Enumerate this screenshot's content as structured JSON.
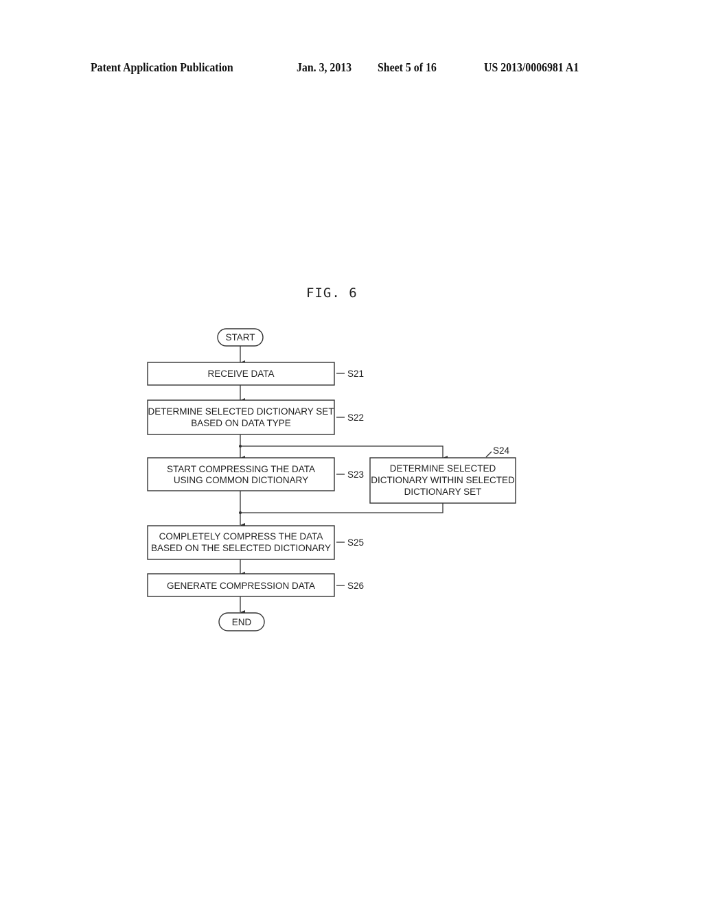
{
  "header": {
    "publication": "Patent Application Publication",
    "date": "Jan. 3, 2013",
    "sheet": "Sheet 5 of 16",
    "number": "US 2013/0006981 A1"
  },
  "figure": {
    "title": "FIG. 6",
    "start_label": "START",
    "end_label": "END",
    "steps": [
      {
        "id": "S21",
        "lines": [
          "RECEIVE DATA"
        ]
      },
      {
        "id": "S22",
        "lines": [
          "DETERMINE SELECTED DICTIONARY SET",
          "BASED ON DATA TYPE"
        ]
      },
      {
        "id": "S23",
        "lines": [
          "START COMPRESSING THE DATA",
          "USING COMMON DICTIONARY"
        ]
      },
      {
        "id": "S24",
        "lines": [
          "DETERMINE SELECTED",
          "DICTIONARY WITHIN SELECTED",
          "DICTIONARY SET"
        ]
      },
      {
        "id": "S25",
        "lines": [
          "COMPLETELY COMPRESS THE DATA",
          "BASED ON THE SELECTED DICTIONARY"
        ]
      },
      {
        "id": "S26",
        "lines": [
          "GENERATE COMPRESSION DATA"
        ]
      }
    ]
  }
}
